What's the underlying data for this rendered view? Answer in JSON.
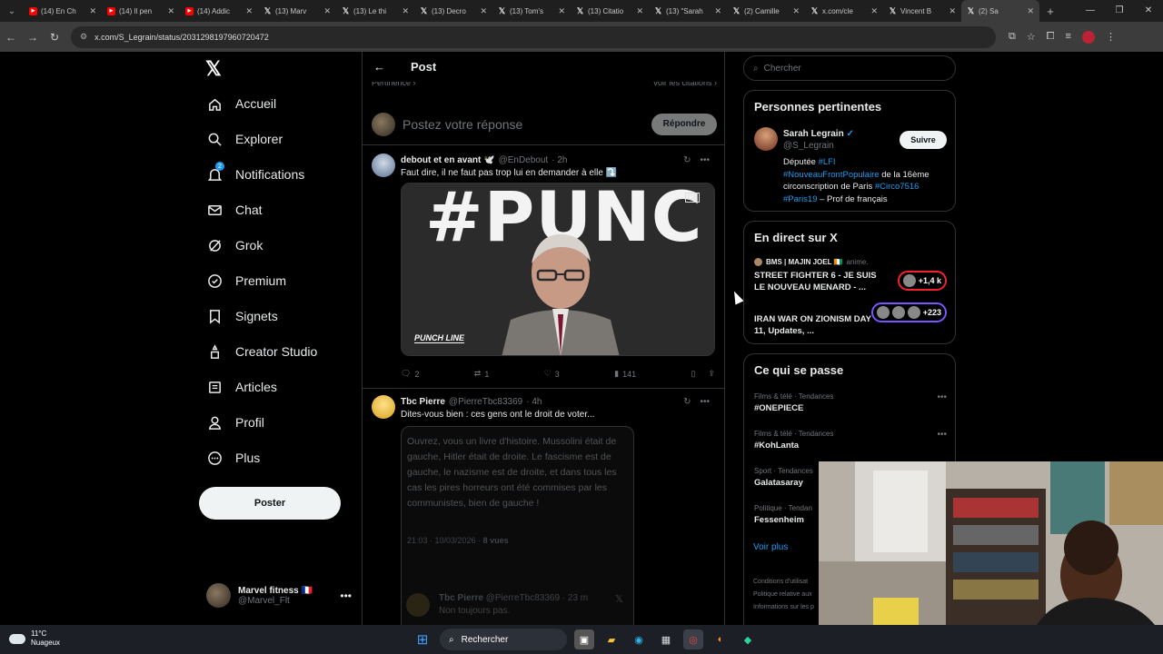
{
  "browser": {
    "tabs": [
      {
        "label": "(14) En Ch",
        "icon": "youtube-icon"
      },
      {
        "label": "(14) Il pen",
        "icon": "youtube-icon"
      },
      {
        "label": "(14) Addic",
        "icon": "youtube-icon"
      },
      {
        "label": "(13) Marv",
        "icon": "x-icon"
      },
      {
        "label": "(13) Le thi",
        "icon": "x-icon"
      },
      {
        "label": "(13) Decro",
        "icon": "x-icon"
      },
      {
        "label": "(13) Tom's",
        "icon": "x-icon"
      },
      {
        "label": "(13) Citatio",
        "icon": "x-icon"
      },
      {
        "label": "(13) \"Sarah",
        "icon": "x-icon"
      },
      {
        "label": "(2) Camille",
        "icon": "x-icon"
      },
      {
        "label": "x.com/cle",
        "icon": "x-icon"
      },
      {
        "label": "Vincent B",
        "icon": "x-icon"
      },
      {
        "label": "(2) Sa",
        "icon": "x-icon",
        "active": true
      }
    ],
    "url": "x.com/S_Legrain/status/2031298197960720472"
  },
  "nav": {
    "items": [
      {
        "label": "Accueil",
        "icon": "home-icon"
      },
      {
        "label": "Explorer",
        "icon": "search-icon"
      },
      {
        "label": "Notifications",
        "icon": "bell-icon",
        "badge": "2"
      },
      {
        "label": "Chat",
        "icon": "mail-icon"
      },
      {
        "label": "Grok",
        "icon": "grok-icon"
      },
      {
        "label": "Premium",
        "icon": "premium-icon"
      },
      {
        "label": "Signets",
        "icon": "bookmark-icon"
      },
      {
        "label": "Creator Studio",
        "icon": "creator-icon"
      },
      {
        "label": "Articles",
        "icon": "articles-icon"
      },
      {
        "label": "Profil",
        "icon": "person-icon"
      },
      {
        "label": "Plus",
        "icon": "more-circle-icon"
      }
    ],
    "post_button": "Poster",
    "account": {
      "name": "Marvel fitness 🇫🇷",
      "handle": "@Marvel_Flt"
    }
  },
  "center": {
    "title": "Post",
    "relevance_left": "Pertinence ›",
    "relevance_right": "Voir les citations ›",
    "reply_placeholder": "Postez votre réponse",
    "reply_button": "Répondre",
    "tweet1": {
      "name": "debout et en avant 🕊️",
      "handle": "@EnDebout",
      "time": "· 2h",
      "text": "Faut dire, il ne faut pas trop lui en demander à elle ⤵️",
      "video_bg_text": "#PUNC",
      "video_logo": "PUNCH LINE",
      "video_channel": "C8",
      "stats": {
        "replies": "2",
        "reposts": "1",
        "likes": "3",
        "views": "141"
      }
    },
    "tweet2": {
      "name": "Tbc Pierre",
      "handle": "@PierreTbc83369",
      "time": "· 4h",
      "text": "Dites-vous bien : ces gens ont le droit de voter...",
      "quote_text": "Ouvrez, vous un livre d'histoire. Mussolini était de gauche, Hitler était de droite. Le fascisme est de gauche, le nazisme est de droite, et dans tous les cas les pires horreurs ont été commises par les communistes, bien de gauche !",
      "quote_time": "21:03 · 10/03/2026 · ",
      "quote_views": "8 vues",
      "sub_name": "Tbc Pierre",
      "sub_handle": "@PierreTbc83369 · 23 m",
      "sub_text": "Non toujours pas."
    }
  },
  "right": {
    "search_placeholder": "Chercher",
    "people": {
      "title": "Personnes pertinentes",
      "name": "Sarah Legrain",
      "handle": "@S_Legrain",
      "follow": "Suivre",
      "bio_1": "Députée ",
      "bio_tag1": "#LFI",
      "bio_tag2": "#NouveauFrontPopulaire",
      "bio_2": " de la 16ème circonscription de Paris ",
      "bio_tag3": "#Circo7516",
      "bio_tag4": "#Paris19",
      "bio_3": " – Prof de français"
    },
    "live": {
      "title": "En direct sur X",
      "items": [
        {
          "host": "BMS | MAJIN JOEL 🇨🇮",
          "suffix": "anime.",
          "title": "STREET FIGHTER 6 - JE SUIS LE NOUVEAU MENARD - ...",
          "badge": "+1,4 k",
          "color": "#f4212e"
        },
        {
          "host": "",
          "suffix": "",
          "title": "IRAN WAR ON ZIONISM DAY 11, Updates, ...",
          "badge": "+223",
          "color": "#7856ff"
        }
      ]
    },
    "trends": {
      "title": "Ce qui se passe",
      "items": [
        {
          "cat": "Films & télé · Tendances",
          "name": "#ONEPIECE"
        },
        {
          "cat": "Films & télé · Tendances",
          "name": "#KohLanta"
        },
        {
          "cat": "Sport · Tendances",
          "name": "Galatasaray"
        },
        {
          "cat": "Politique · Tendan",
          "name": "Fessenheim"
        }
      ],
      "see_all": "Voir plus"
    },
    "footer": [
      "Conditions d'utilisat",
      "Politique relative aux",
      "Informations sur les p"
    ]
  },
  "taskbar": {
    "temp": "11°C",
    "weather": "Nuageux",
    "search": "Rechercher"
  }
}
